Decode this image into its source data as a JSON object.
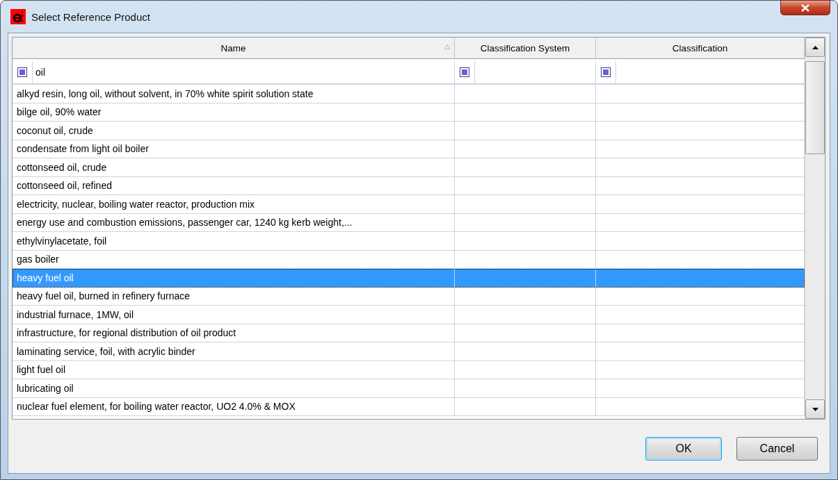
{
  "window": {
    "title": "Select Reference Product"
  },
  "table": {
    "columns": [
      {
        "label": "Name",
        "sorted": true,
        "has_filter": true,
        "filter_value": "oil"
      },
      {
        "label": "Classification System",
        "sorted": false,
        "has_filter": true
      },
      {
        "label": "Classification",
        "sorted": false,
        "has_filter": true
      }
    ],
    "rows": [
      {
        "name": "alkyd resin, long oil, without solvent, in 70% white spirit solution state",
        "selected": false
      },
      {
        "name": "bilge oil, 90% water",
        "selected": false
      },
      {
        "name": "coconut oil, crude",
        "selected": false
      },
      {
        "name": "condensate from light oil boiler",
        "selected": false
      },
      {
        "name": "cottonseed oil, crude",
        "selected": false
      },
      {
        "name": "cottonseed oil, refined",
        "selected": false
      },
      {
        "name": "electricity, nuclear, boiling water reactor, production mix",
        "selected": false
      },
      {
        "name": "energy use and combustion emissions, passenger car, 1240 kg kerb weight,...",
        "selected": false
      },
      {
        "name": "ethylvinylacetate, foil",
        "selected": false
      },
      {
        "name": "gas boiler",
        "selected": false
      },
      {
        "name": "heavy fuel oil",
        "selected": true
      },
      {
        "name": "heavy fuel oil, burned in refinery furnace",
        "selected": false
      },
      {
        "name": "industrial furnace, 1MW, oil",
        "selected": false
      },
      {
        "name": "infrastructure, for regional distribution of oil product",
        "selected": false
      },
      {
        "name": "laminating service, foil, with acrylic binder",
        "selected": false
      },
      {
        "name": "light fuel oil",
        "selected": false
      },
      {
        "name": "lubricating oil",
        "selected": false
      },
      {
        "name": "nuclear fuel element, for boiling water reactor, UO2 4.0% & MOX",
        "selected": false
      }
    ]
  },
  "buttons": [
    {
      "label": "OK",
      "default": true
    },
    {
      "label": "Cancel",
      "default": false
    }
  ]
}
